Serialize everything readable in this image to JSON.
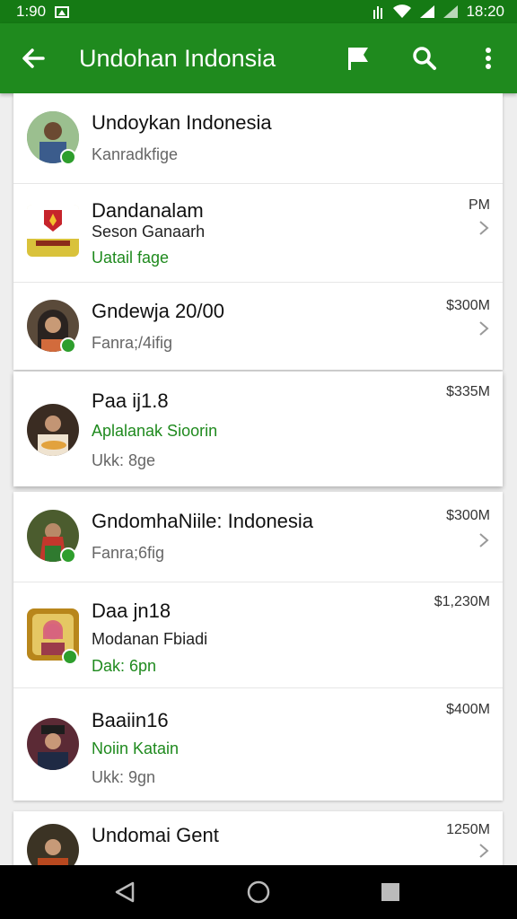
{
  "status": {
    "time_left": "1:90",
    "time_right": "18:20",
    "icons": [
      "gallery-icon",
      "signal-icon",
      "wifi-icon",
      "cell-signal-icon",
      "battery-icon"
    ]
  },
  "appbar": {
    "title": "Undohan Indonsia",
    "icons": [
      "back-arrow-icon",
      "flag-icon",
      "search-icon",
      "more-vert-icon"
    ],
    "color": "#1f8a1e"
  },
  "colors": {
    "accent": "#1f8a1e",
    "status_bar": "#157a14"
  },
  "items": [
    {
      "name": "Undoykan Indonesia",
      "line2": "Kanradkfige",
      "line3": "",
      "meta": ""
    },
    {
      "name": "Dandanalam",
      "line2": "Seson Ganaarh",
      "line3": "Uatail fage",
      "meta": "PM"
    },
    {
      "name": "Gndewja 20/00",
      "line2": "Fanra;/4ifig",
      "line3": "",
      "meta": "$300M"
    },
    {
      "name": "Paa ij1.8",
      "line2": "Aplalanak Sioorin",
      "line3": "Ukk: 8ge",
      "meta": "$335M"
    },
    {
      "name": "GndomhaNiile: Indonesia",
      "line2": "Fanra;6fig",
      "line3": "",
      "meta": "$300M"
    },
    {
      "name": "Daa jn18",
      "line2": "Modanan Fbiadi",
      "line3": "Dak: 6pn",
      "meta": "$1,230M"
    },
    {
      "name": "Baaiin16",
      "line2": "Noiin Katain",
      "line3": "Ukk: 9gn",
      "meta": "$400M"
    },
    {
      "name": "Undomai Gent",
      "line2": "",
      "line3": "",
      "meta": "1250M"
    }
  ],
  "nav": {
    "icons": [
      "back-triangle-icon",
      "home-circle-icon",
      "recents-square-icon"
    ]
  }
}
